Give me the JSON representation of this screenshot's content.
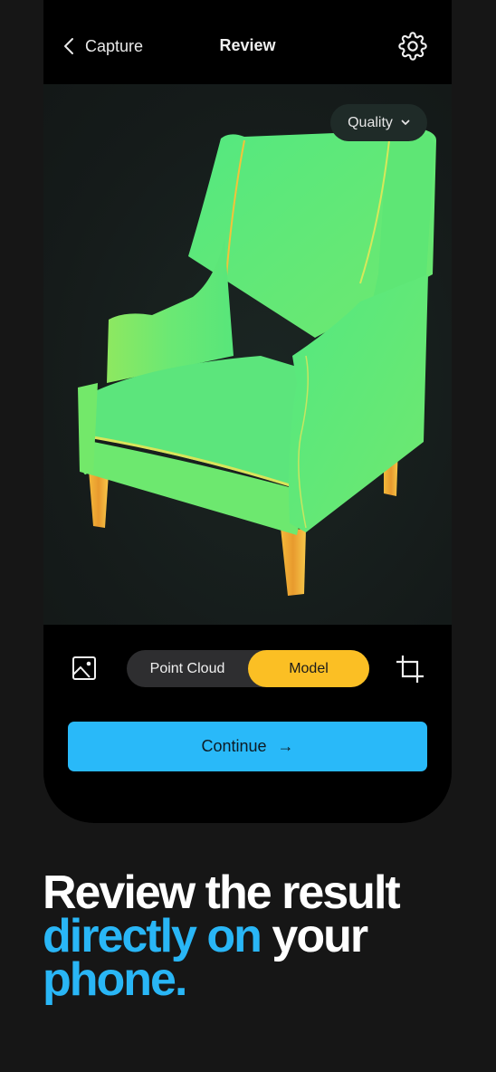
{
  "header": {
    "back_label": "Capture",
    "title": "Review",
    "back_icon": "chevron-left-icon",
    "settings_icon": "gear-icon"
  },
  "viewport": {
    "quality_label": "Quality",
    "quality_icon": "chevron-down-icon",
    "subject": "armchair 3D model (heatmap quality view)"
  },
  "controls": {
    "gallery_icon": "image-icon",
    "crop_icon": "crop-icon",
    "segments": [
      {
        "label": "Point Cloud",
        "active": false
      },
      {
        "label": "Model",
        "active": true
      }
    ]
  },
  "continue": {
    "label": "Continue",
    "arrow": "→"
  },
  "headline": {
    "part1": "Review the result",
    "part2_blue": "directly on",
    "part3": "your",
    "part4_blue": "phone."
  },
  "colors": {
    "background": "#161616",
    "phone": "#000000",
    "accent_blue": "#29b9f9",
    "accent_yellow": "#fbbf24",
    "heatmap_green": "#4ee67f"
  }
}
